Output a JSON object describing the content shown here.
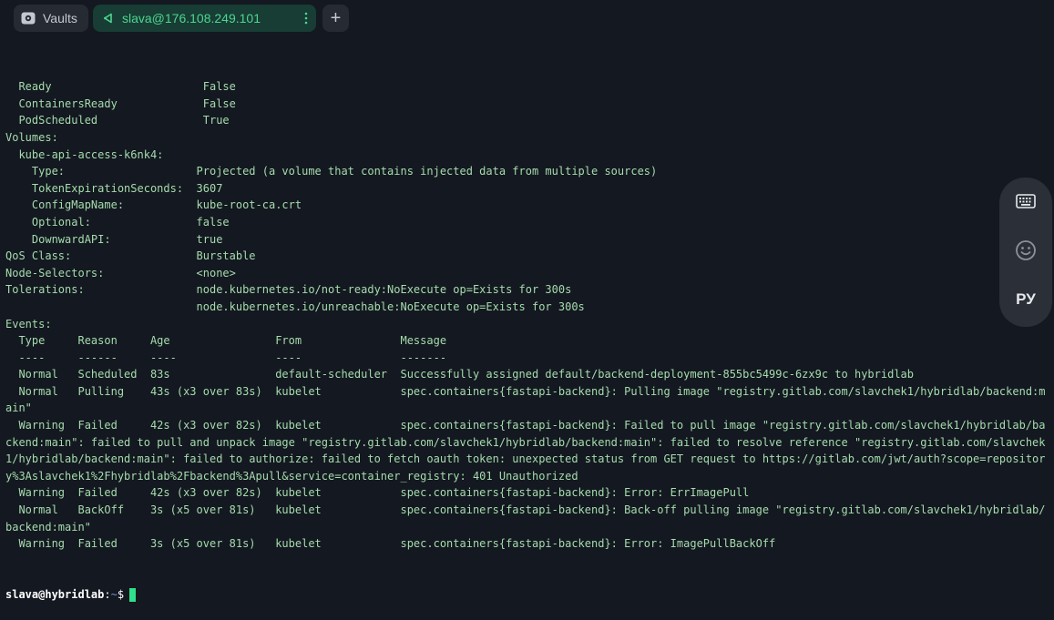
{
  "tabs": {
    "vaults_label": "Vaults",
    "ssh_label": "slava@176.108.249.101",
    "add_label": "+"
  },
  "terminal": {
    "lines": [
      "  Ready                       False",
      "  ContainersReady             False",
      "  PodScheduled                True",
      "Volumes:",
      "  kube-api-access-k6nk4:",
      "    Type:                    Projected (a volume that contains injected data from multiple sources)",
      "    TokenExpirationSeconds:  3607",
      "    ConfigMapName:           kube-root-ca.crt",
      "    Optional:                false",
      "    DownwardAPI:             true",
      "QoS Class:                   Burstable",
      "Node-Selectors:              <none>",
      "Tolerations:                 node.kubernetes.io/not-ready:NoExecute op=Exists for 300s",
      "                             node.kubernetes.io/unreachable:NoExecute op=Exists for 300s",
      "Events:",
      "  Type     Reason     Age                From               Message",
      "  ----     ------     ----               ----               -------",
      "  Normal   Scheduled  83s                default-scheduler  Successfully assigned default/backend-deployment-855bc5499c-6zx9c to hybridlab",
      "  Normal   Pulling    43s (x3 over 83s)  kubelet            spec.containers{fastapi-backend}: Pulling image \"registry.gitlab.com/slavchek1/hybridlab/backend:m",
      "ain\"",
      "  Warning  Failed     42s (x3 over 82s)  kubelet            spec.containers{fastapi-backend}: Failed to pull image \"registry.gitlab.com/slavchek1/hybridlab/ba",
      "ckend:main\": failed to pull and unpack image \"registry.gitlab.com/slavchek1/hybridlab/backend:main\": failed to resolve reference \"registry.gitlab.com/slavchek",
      "1/hybridlab/backend:main\": failed to authorize: failed to fetch oauth token: unexpected status from GET request to https://gitlab.com/jwt/auth?scope=repositor",
      "y%3Aslavchek1%2Fhybridlab%2Fbackend%3Apull&service=container_registry: 401 Unauthorized",
      "  Warning  Failed     42s (x3 over 82s)  kubelet            spec.containers{fastapi-backend}: Error: ErrImagePull",
      "  Normal   BackOff    3s (x5 over 81s)   kubelet            spec.containers{fastapi-backend}: Back-off pulling image \"registry.gitlab.com/slavchek1/hybridlab/",
      "backend:main\"",
      "  Warning  Failed     3s (x5 over 81s)   kubelet            spec.containers{fastapi-backend}: Error: ImagePullBackOff"
    ],
    "prompt": {
      "user_host": "slava@hybridlab",
      "separator": ":",
      "path": "~",
      "symbol": "$"
    },
    "text_color": "#a5dcae",
    "cursor_color": "#2fe08a"
  },
  "side_panel": {
    "keyboard_icon": "keyboard-icon",
    "emoji_icon": "emoji-icon",
    "language_label": "РУ"
  }
}
